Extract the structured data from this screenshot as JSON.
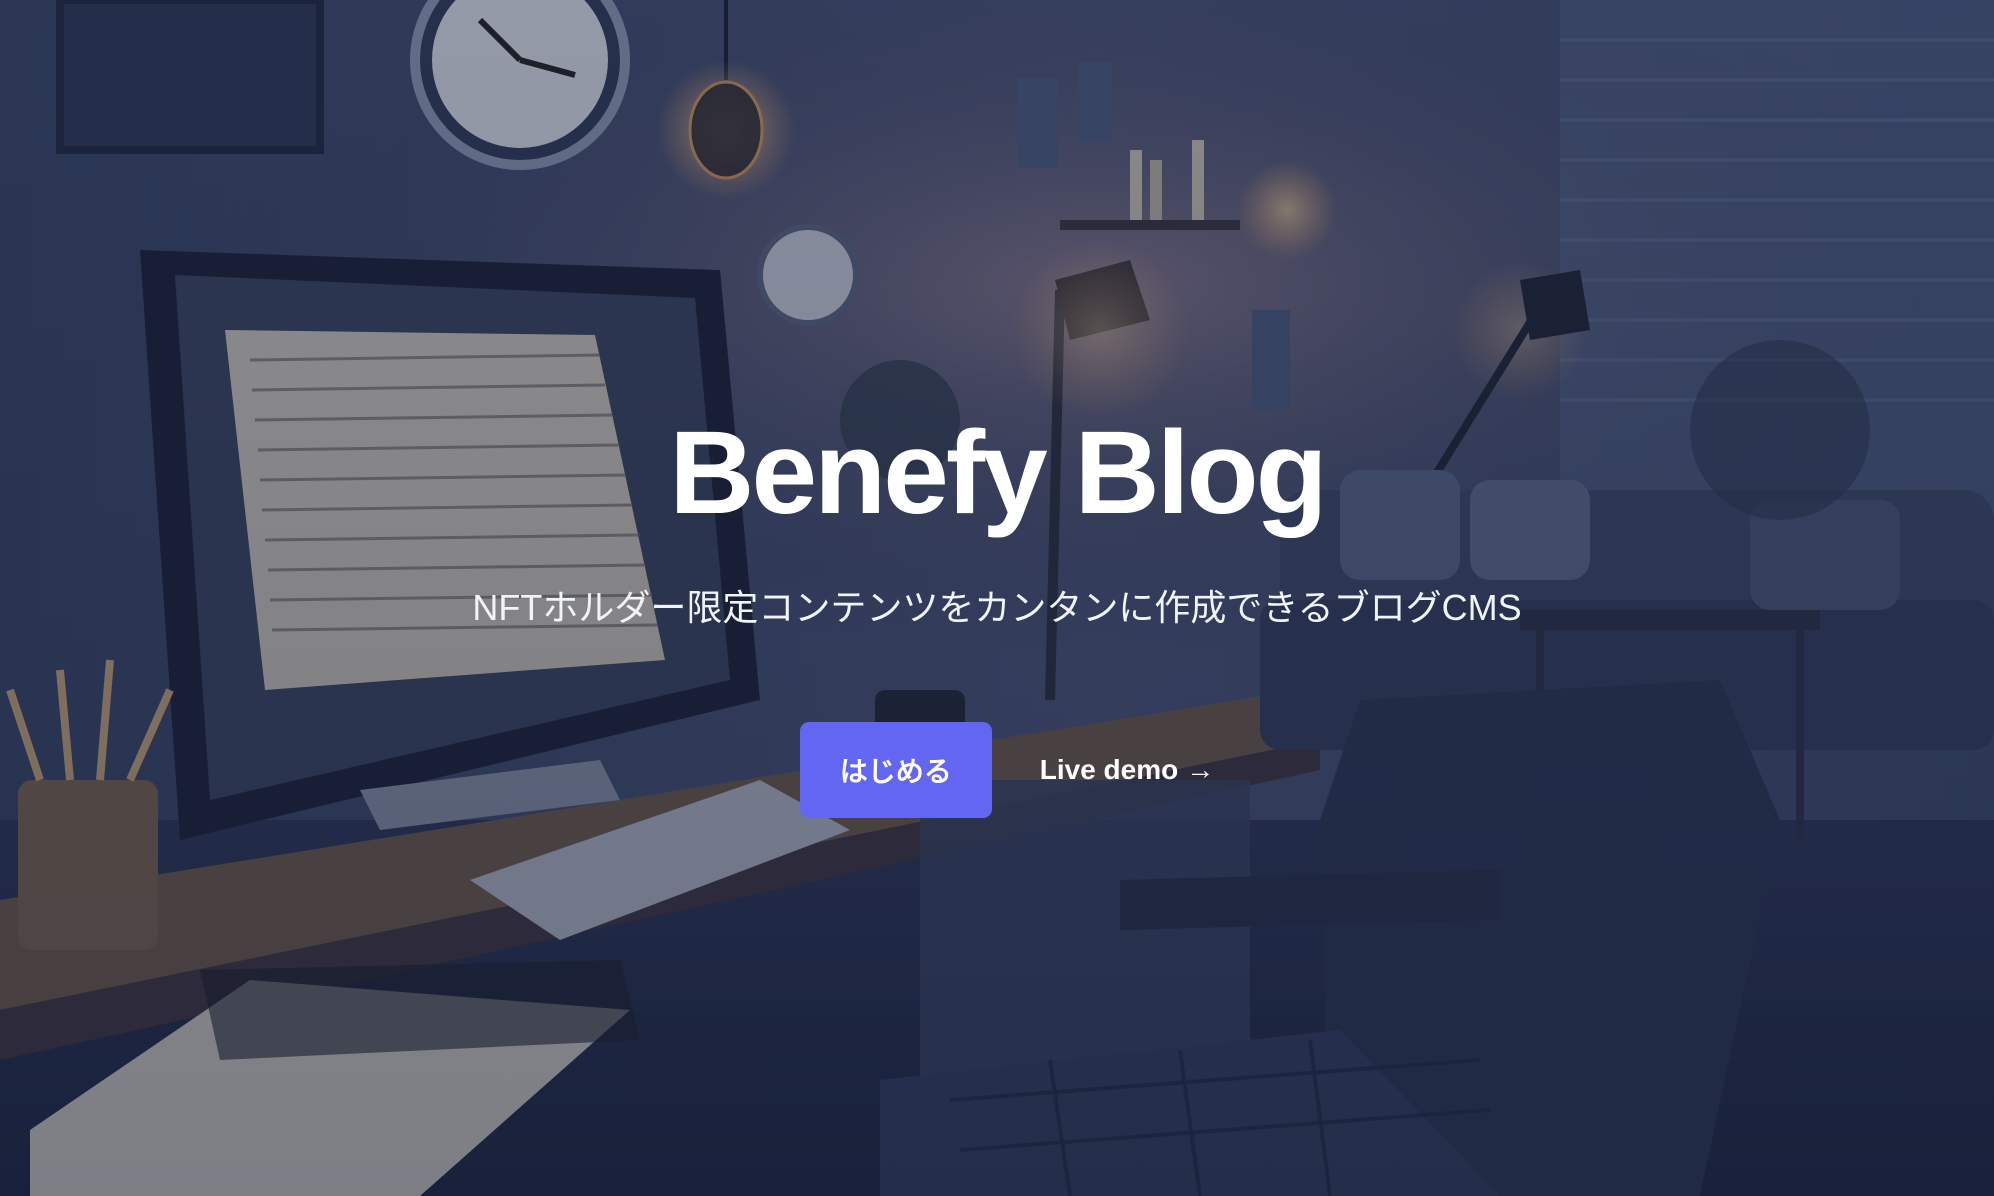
{
  "hero": {
    "title": "Benefy Blog",
    "subtitle": "NFTホルダー限定コンテンツをカンタンに作成できるブログCMS",
    "primary_button_label": "はじめる",
    "secondary_link_label": "Live demo",
    "secondary_link_arrow": "→",
    "background_image": "dark-home-office-illustration",
    "accent_color": "#6366f1"
  }
}
